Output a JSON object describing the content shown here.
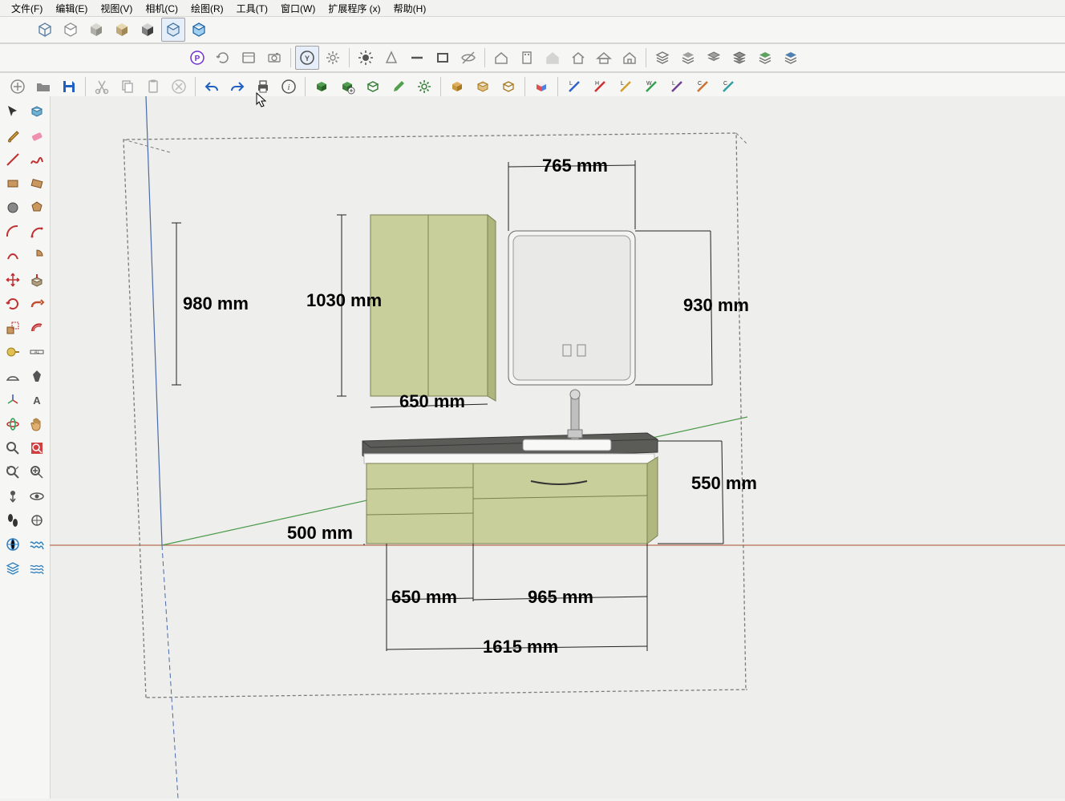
{
  "menus": {
    "file": "文件(F)",
    "edit": "编辑(E)",
    "view": "视图(V)",
    "camera": "相机(C)",
    "draw": "绘图(R)",
    "tools": "工具(T)",
    "window": "窗口(W)",
    "ext": "扩展程序 (x)",
    "help": "帮助(H)"
  },
  "dims": {
    "d980": "980 mm",
    "d1030": "1030 mm",
    "d650a": "650 mm",
    "d765": "765 mm",
    "d930": "930 mm",
    "d500": "500 mm",
    "d550": "550 mm",
    "d650b": "650 mm",
    "d965": "965 mm",
    "d1615": "1615 mm"
  },
  "colors": {
    "cabinet": "#c8cf9a",
    "cabinetEdge": "#7a8050",
    "counter": "#5b5b58",
    "white": "#f8f8f6"
  }
}
